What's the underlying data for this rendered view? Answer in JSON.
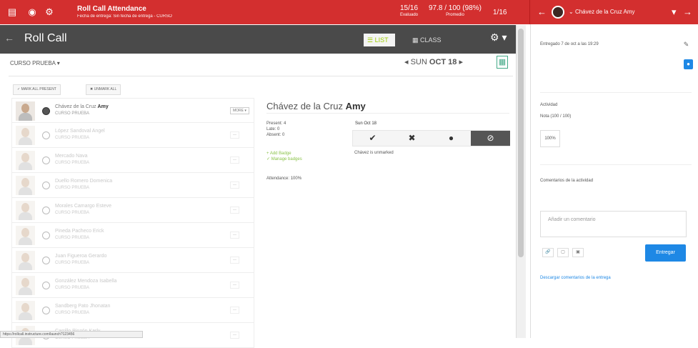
{
  "topbar": {
    "title": "Roll Call Attendance",
    "subtitle": "Fecha de entrega: Sin fecha de entrega - CURSO",
    "stat1_value": "15/16",
    "stat1_label": "Evaluado",
    "stat2_value": "97.8 / 100 (98%)",
    "stat2_label": "Promedio",
    "stat3_value": "1/16",
    "student_name": "Chávez de la Cruz Amy"
  },
  "section": {
    "back_arrow": "←",
    "title": "Roll Call",
    "tab_list": "LIST",
    "tab_class": "CLASS",
    "gear": "⚙ ▾"
  },
  "filters": {
    "course": "CURSO PRUEBA ▾",
    "date_prev": "◂",
    "date_day": "SUN",
    "date_text": "OCT 18",
    "date_next": "▸",
    "calendar": "▦"
  },
  "actions": {
    "mark_all": "✓ MARK ALL PRESENT",
    "unmark_all": "✖ UNMARK ALL"
  },
  "students": [
    {
      "name_light": "Chávez de la Cruz",
      "name_bold": "Amy",
      "course": "CURSO PRUEBA",
      "dropdown": "MORE ▾"
    },
    {
      "name_light": "López Sandoval Angel",
      "name_bold": "",
      "course": "CURSO PRUEBA",
      "dropdown": "—"
    },
    {
      "name_light": "Mercado Nava",
      "name_bold": "",
      "course": "CURSO PRUEBA",
      "dropdown": "—"
    },
    {
      "name_light": "Duello Romero Domenica",
      "name_bold": "",
      "course": "CURSO PRUEBA",
      "dropdown": "—"
    },
    {
      "name_light": "Morales Camargo Esteve",
      "name_bold": "",
      "course": "CURSO PRUEBA",
      "dropdown": "—"
    },
    {
      "name_light": "Pineda Pacheco Erick",
      "name_bold": "",
      "course": "CURSO PRUEBA",
      "dropdown": "—"
    },
    {
      "name_light": "Juan Figueroa Gerardo",
      "name_bold": "",
      "course": "CURSO PRUEBA",
      "dropdown": "—"
    },
    {
      "name_light": "González Mendoza Isabella",
      "name_bold": "",
      "course": "CURSO PRUEBA",
      "dropdown": "—"
    },
    {
      "name_light": "Sandberg Pato Jhonatan",
      "name_bold": "",
      "course": "CURSO PRUEBA",
      "dropdown": "—"
    },
    {
      "name_light": "Carrillo Pinzón Karly",
      "name_bold": "",
      "course": "CURSO PRUEBA",
      "dropdown": "—"
    }
  ],
  "detail": {
    "name_light": "Chávez de la Cruz",
    "name_bold": "Amy",
    "present": "Present: 4",
    "late": "Late: 0",
    "absent": "Absent: 0",
    "add_badge": "+ Add Badge",
    "manage_badges": "✓ Manage badges",
    "attendance": "Attendance: 100%",
    "date_label": "Sun Oct 18",
    "btn_present": "✔",
    "btn_absent": "✖",
    "btn_late": "●",
    "btn_excused": "⊘",
    "note": "Chávez is unmarked"
  },
  "right_panel": {
    "delivered": "Entregado 7 de oct a las 19:29",
    "edit_icon": "✎",
    "blue_btn": "●",
    "activity_label": "Actividad",
    "note_label": "Nota (100 / 100)",
    "grade": "100%",
    "comments_label": "Comentarios de la actividad",
    "comment_placeholder": "Añadir un comentario",
    "mini1": "🔗",
    "mini2": "▢",
    "mini3": "▣",
    "submit": "Entregar",
    "download": "Descargar comentarios de la entrega"
  },
  "status_url": "https://rollcall.instructure.com/launch?123456"
}
